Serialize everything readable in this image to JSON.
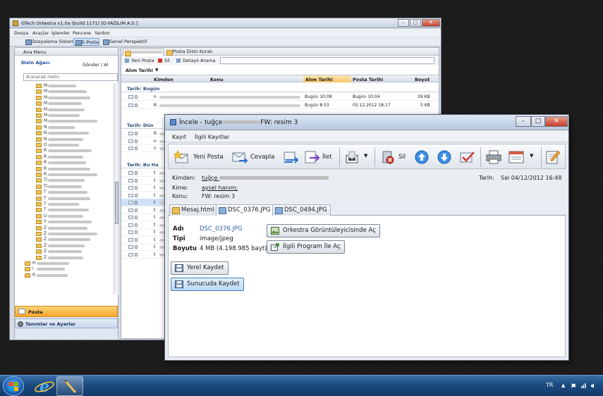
{
  "main_window": {
    "title": "GTech Orkestra v1.0a (build 1171) [G-YAZILIM A.S.]",
    "menu": [
      "Dosya",
      "Araçlar",
      "İşlemler",
      "Pencere",
      "Yardım"
    ],
    "perspectives": [
      "Dosyalama Sistemi",
      "E-Posta",
      "Genel Perspektif"
    ],
    "left_pane": {
      "title": "Ana Menu",
      "tree_title": "Dizin Ağacı",
      "send_recv": "Gönder / Al",
      "search_placeholder": "Aranacak metin",
      "nav_items": [
        "Posta",
        "Tanımlar ve Ayarlar"
      ]
    },
    "right_pane": {
      "tabs": [
        "Posta Dizin Kuralı"
      ],
      "toolbar": [
        "Yeni Posta",
        "Sil",
        "Detaylı Arama"
      ],
      "sort_label": "Alım Tarihi",
      "columns": [
        "Kimden",
        "Konu",
        "Alım Tarihi",
        "Posta Tarihi",
        "Boyut"
      ],
      "groups": [
        "Tarih: Bugün",
        "Tarih: Dün",
        "Tarih: Bu Ha"
      ],
      "rows_today": [
        {
          "from_initial": "n",
          "recv": "Bugün 10:08",
          "post": "Bugün 10:04",
          "size": "39 KB"
        },
        {
          "from_initial": "R",
          "recv": "Bugün 8:53",
          "post": "05.12.2012 18:17",
          "size": "5 KB"
        }
      ],
      "row_initials_yesterday": [
        "R",
        "n",
        "n"
      ],
      "row_initials_week": [
        "t",
        "t",
        "t",
        "t",
        "t",
        "t",
        "t",
        "t",
        "t",
        "t",
        "t",
        "t"
      ]
    }
  },
  "dialog": {
    "title_prefix": "İncele - tuğçe",
    "title_suffix": "FW: resim 3",
    "menu": [
      "Kayıt",
      "İlgili Kayıtlar"
    ],
    "toolbar": {
      "new_mail": "Yeni Posta",
      "reply": "Cevapla",
      "forward": "İlet",
      "delete": "Sil"
    },
    "header": {
      "from_label": "Kimden:",
      "from_value": "tuğçe",
      "to_label": "Kime:",
      "to_value": "aysel hanım;",
      "subject_label": "Konu:",
      "subject_value": "FW: resim 3",
      "date_label": "Tarih:",
      "date_value": "Sal 04/12/2012 16:48"
    },
    "attachment_tabs": [
      "Mesaj.html",
      "DSC_0376.JPG",
      "DSC_0494.JPG"
    ],
    "attachment": {
      "name_label": "Adı",
      "name_value": "DSC_0376.JPG",
      "type_label": "Tipi",
      "type_value": "image/jpeg",
      "size_label": "Boyutu",
      "size_value": "4 MB (4.198.985 bayt)"
    },
    "buttons": {
      "open_viewer": "Orkestra Görüntüleyicisinde Aç",
      "open_program": "İlgili Program İle Aç",
      "save_local": "Yerel Kaydet",
      "save_server": "Sunucuda Kaydet"
    }
  },
  "taskbar": {
    "language": "TR"
  },
  "colors": {
    "accent_orange": "#f6a72b",
    "selection_blue": "#cfe1f8",
    "link_blue": "#2b5ca8",
    "taskbar": "#1b4a80"
  }
}
